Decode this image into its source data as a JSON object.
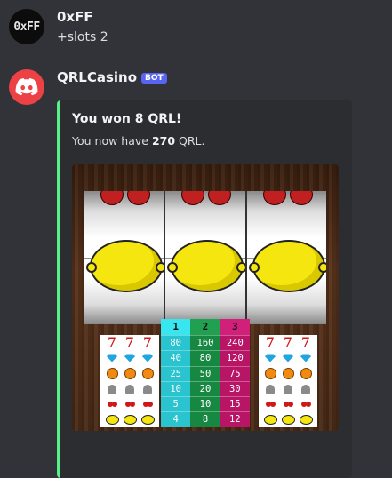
{
  "messages": [
    {
      "author": "0xFF",
      "avatar_text": "0xFF",
      "content": "+slots 2"
    },
    {
      "author": "QRLCasino",
      "bot_tag": "BOT",
      "embed": {
        "title": "You won 8 QRL!",
        "desc_prefix": "You now have ",
        "desc_amount": "270",
        "desc_suffix": " QRL.",
        "accent_color": "#57f287"
      }
    }
  ],
  "slot": {
    "reels": [
      "lemon",
      "lemon",
      "lemon"
    ],
    "paytable_headers": [
      "1",
      "2",
      "3"
    ],
    "paytable": [
      {
        "symbol": "seven-icon",
        "left": "7 7 7",
        "payouts": [
          "80",
          "160",
          "240"
        ]
      },
      {
        "symbol": "diamond-icon",
        "payouts": [
          "40",
          "80",
          "120"
        ]
      },
      {
        "symbol": "coin-icon",
        "payouts": [
          "25",
          "50",
          "75"
        ]
      },
      {
        "symbol": "bell-icon",
        "payouts": [
          "10",
          "20",
          "30"
        ]
      },
      {
        "symbol": "cherry-icon",
        "payouts": [
          "5",
          "10",
          "15"
        ]
      },
      {
        "symbol": "lemon-icon",
        "payouts": [
          "4",
          "8",
          "12"
        ]
      }
    ]
  }
}
